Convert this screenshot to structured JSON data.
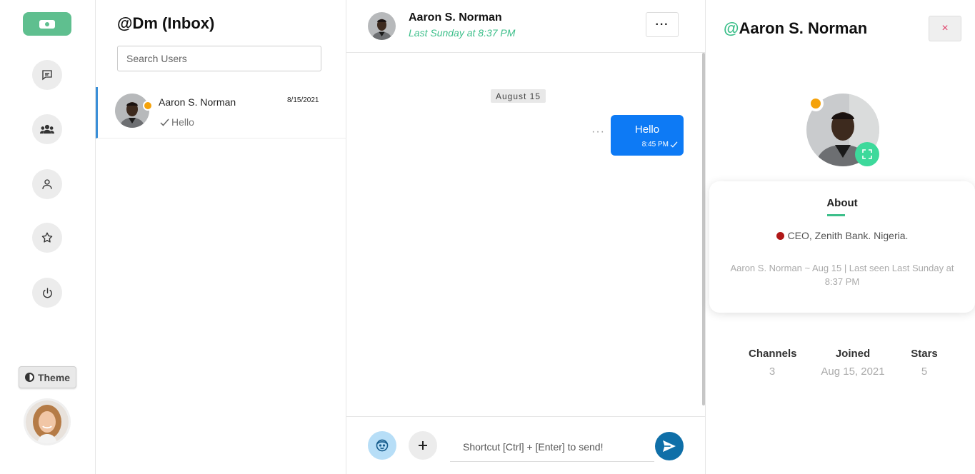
{
  "rail": {
    "nav": [
      {
        "icon": "chat-icon"
      },
      {
        "icon": "groups-icon"
      },
      {
        "icon": "user-icon"
      },
      {
        "icon": "star-icon"
      },
      {
        "icon": "power-icon"
      }
    ],
    "theme_label": "Theme"
  },
  "inbox": {
    "title": "@Dm (Inbox)",
    "search_placeholder": "Search Users",
    "conversations": [
      {
        "name": "Aaron S. Norman",
        "date": "8/15/2021",
        "preview": "Hello",
        "status_color": "#f5a20a"
      }
    ]
  },
  "chat": {
    "name": "Aaron S. Norman",
    "last_seen": "Last Sunday at 8:37 PM",
    "more_label": "···",
    "day_chip": "August 15",
    "messages": [
      {
        "text": "Hello",
        "time": "8:45 PM",
        "outgoing": true
      }
    ],
    "input_placeholder": "Shortcut [Ctrl] + [Enter] to send!",
    "accent": "#0d7af5"
  },
  "profile": {
    "at": "@",
    "name": "Aaron S. Norman",
    "close_label": "×",
    "about_tab": "About",
    "role": "CEO, Zenith Bank. Nigeria.",
    "meta": "Aaron S. Norman ~ Aug 15 | Last seen Last Sunday at 8:37 PM",
    "stats": [
      {
        "label": "Channels",
        "value": "3"
      },
      {
        "label": "Joined",
        "value": "Aug 15, 2021"
      },
      {
        "label": "Stars",
        "value": "5"
      }
    ],
    "accent": "#3cbf8a"
  }
}
